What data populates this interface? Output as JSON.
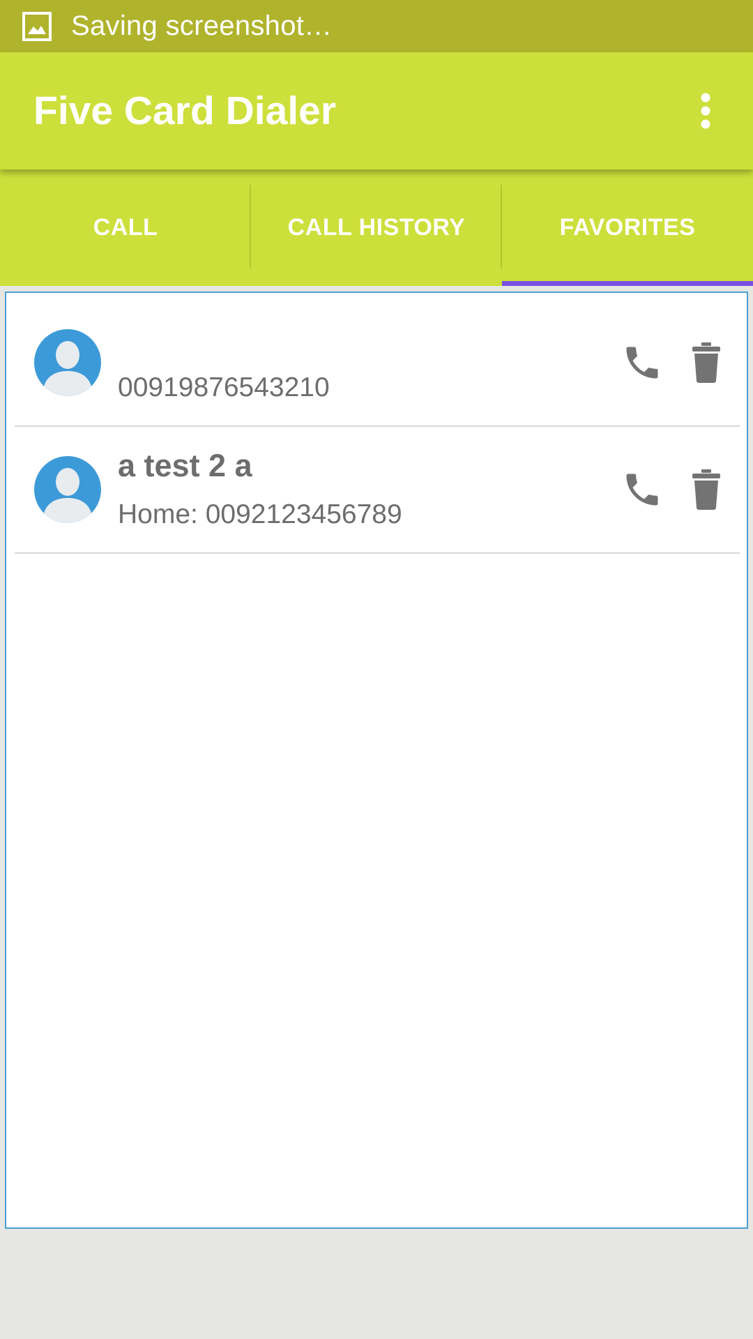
{
  "status_bar": {
    "notification_icon": "screenshot-image-icon",
    "text": "Saving screenshot…"
  },
  "app_bar": {
    "title": "Five Card Dialer",
    "overflow_icon": "more-vertical-icon"
  },
  "tabs": [
    {
      "label": "CALL",
      "selected": false
    },
    {
      "label": "CALL HISTORY",
      "selected": false
    },
    {
      "label": "FAVORITES",
      "selected": true
    }
  ],
  "favorites": [
    {
      "name": "",
      "number": "00919876543210"
    },
    {
      "name": "a test 2 a",
      "number": "Home: 0092123456789"
    }
  ],
  "icons": {
    "avatar": "person-avatar-icon",
    "call": "phone-icon",
    "delete": "trash-icon"
  },
  "colors": {
    "status_bar": "#b0b32c",
    "primary": "#cddf3a",
    "tab_indicator": "#7a4fe0",
    "avatar": "#3d9ad8",
    "card_border": "#4b9fd4",
    "text_secondary": "#6d6d6d"
  }
}
